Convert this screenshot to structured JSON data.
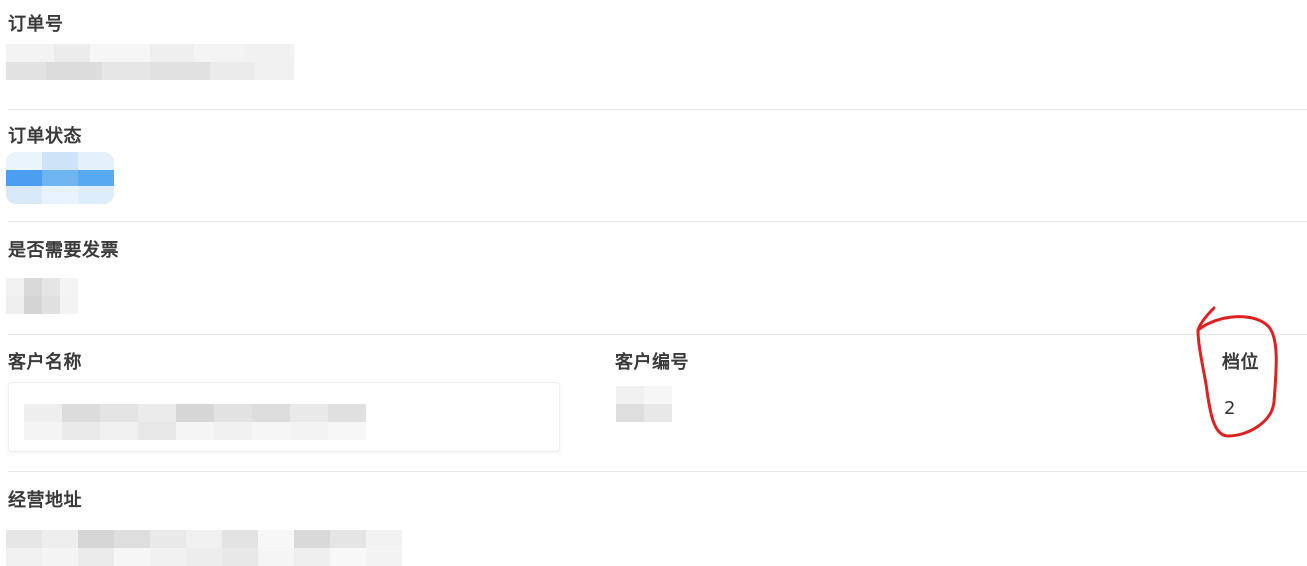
{
  "fields": {
    "order_no": {
      "label": "订单号"
    },
    "order_status": {
      "label": "订单状态"
    },
    "need_invoice": {
      "label": "是否需要发票"
    },
    "customer_name": {
      "label": "客户名称"
    },
    "customer_no": {
      "label": "客户编号"
    },
    "tier": {
      "label": "档位",
      "value": "2"
    },
    "business_address": {
      "label": "经营地址"
    }
  },
  "colors": {
    "annotation": "#e02020",
    "status_blue": "#5aa9ee"
  }
}
